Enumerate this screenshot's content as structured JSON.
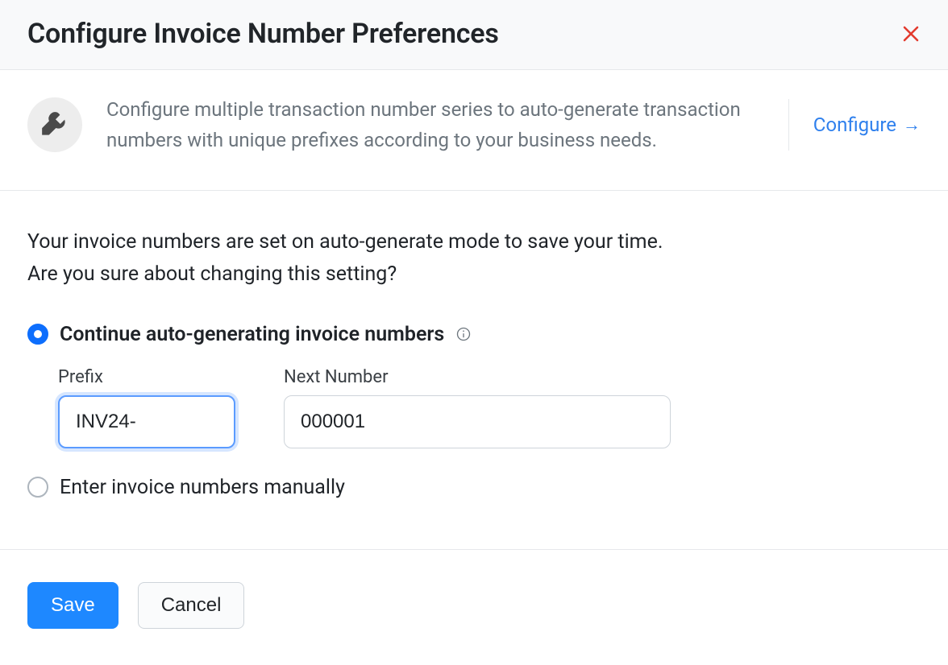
{
  "header": {
    "title": "Configure Invoice Number Preferences"
  },
  "banner": {
    "text": "Configure multiple transaction number series to auto-generate transaction numbers with unique prefixes according to your business needs.",
    "link_label": "Configure"
  },
  "body": {
    "intro_line1": "Your invoice numbers are set on auto-generate mode to save your time.",
    "intro_line2": "Are you sure about changing this setting?",
    "option_auto_label": "Continue auto-generating invoice numbers",
    "prefix_label": "Prefix",
    "prefix_value": "INV24-",
    "next_label": "Next Number",
    "next_value": "000001",
    "option_manual_label": "Enter invoice numbers manually"
  },
  "footer": {
    "save_label": "Save",
    "cancel_label": "Cancel"
  },
  "colors": {
    "primary": "#1e88ff",
    "danger": "#e33b2e",
    "link": "#2f80ed",
    "muted": "#6c757d"
  }
}
